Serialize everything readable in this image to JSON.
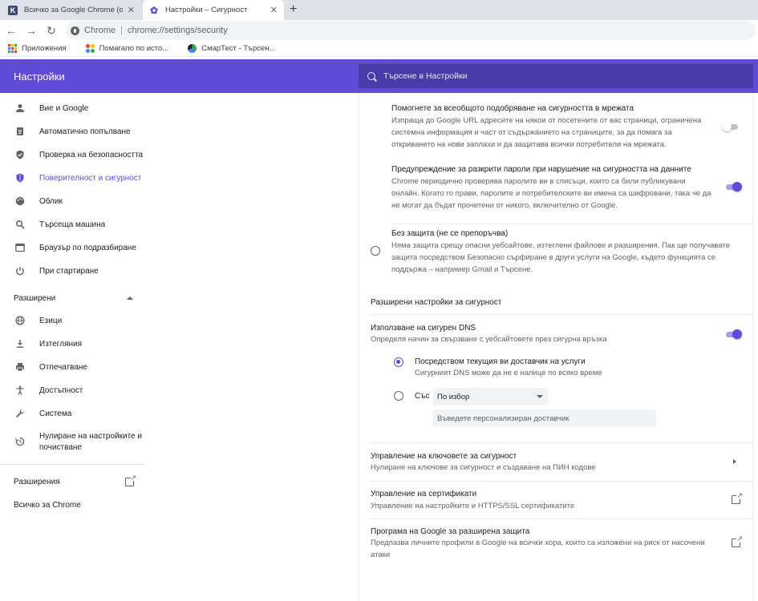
{
  "browser": {
    "tabs": [
      {
        "title": "Всичко за Google Chrome (обе;",
        "favicon": "k-logo-icon",
        "active": false
      },
      {
        "title": "Настройки – Сигурност",
        "favicon": "gear-icon",
        "active": true
      }
    ],
    "omnibox": {
      "site": "Chrome",
      "separator": "|",
      "url": "chrome://settings/security"
    },
    "bookmarks": [
      {
        "label": "Приложения",
        "icon": "apps-grid-icon"
      },
      {
        "label": "Помагало по исто...",
        "icon": "colorful-dots-icon"
      },
      {
        "label": "СмарТест - Търсен...",
        "icon": "globe-icon"
      }
    ]
  },
  "header": {
    "title": "Настройки",
    "search_placeholder": "Търсене в Настройки",
    "color": "#5f4bd7"
  },
  "sidebar": {
    "items": [
      {
        "label": "Вие и Google",
        "icon": "person-icon",
        "active": false
      },
      {
        "label": "Автоматично попълване",
        "icon": "clipboard-icon",
        "active": false
      },
      {
        "label": "Проверка на безопасността",
        "icon": "shield-check-icon",
        "active": false
      },
      {
        "label": "Поверителност и сигурност",
        "icon": "shield-privacy-icon",
        "active": true
      },
      {
        "label": "Облик",
        "icon": "palette-icon",
        "active": false
      },
      {
        "label": "Търсеща машина",
        "icon": "search-icon",
        "active": false
      },
      {
        "label": "Браузър по подразбиране",
        "icon": "browser-icon",
        "active": false
      },
      {
        "label": "При стартиране",
        "icon": "power-icon",
        "active": false
      }
    ],
    "advanced_label": "Разширени",
    "advanced_items": [
      {
        "label": "Езици",
        "icon": "globe-icon"
      },
      {
        "label": "Изтегляния",
        "icon": "download-icon"
      },
      {
        "label": "Отпечатване",
        "icon": "printer-icon"
      },
      {
        "label": "Достъпност",
        "icon": "accessibility-icon"
      },
      {
        "label": "Система",
        "icon": "wrench-icon"
      },
      {
        "label_line1": "Нулиране на настройките и",
        "label_line2": "почистване",
        "icon": "reset-icon"
      }
    ],
    "extensions_label": "Разширения",
    "about_label": "Всичко за Chrome"
  },
  "main": {
    "improve_security": {
      "title": "Помогнете за всеобщото подобряване на сигурността в мрежата",
      "desc_lines": [
        "Изпраща до Google URL адресите на някои от посетените от вас страници, ограничена",
        "системна информация и част от съдържанието на страниците, за да помага за",
        "откриването на нови заплахи и да защитава всички потребители на мрежата."
      ],
      "enabled": false
    },
    "password_leak": {
      "title": "Предупреждение за разкрити пароли при нарушение на сигурността на данните",
      "desc_lines": [
        "Chrome периодично проверява паролите ви в списъци, които са били публикувани",
        "онлайн. Когато го прави, паролите и потребителските ви имена са шифровани, така че да",
        "не могат да бъдат прочетени от никого, включително от Google."
      ],
      "enabled": true
    },
    "no_protection": {
      "title": "Без защита (не се препоръчва)",
      "desc_lines": [
        "Няма защита срещу опасни уебсайтове, изтеглени файлове и разширения. Пак ще получавате",
        "защита посредством Безопасно сърфиране в други услуги на Google, където функцията се",
        "поддържа – например Gmail и Търсене."
      ]
    },
    "advanced_heading": "Разширени настройки за сигурност",
    "secure_dns": {
      "title": "Използване на сигурен DNS",
      "desc": "Определя начин за свързване с уебсайтовете през сигурна връзка",
      "enabled": true,
      "option_current_title": "Посредством текущия ви доставчик на услуги",
      "option_current_desc": "Сигурният DNS може да не е налице по всяко време",
      "option_custom_label": "Със",
      "select_value": "По избор",
      "custom_placeholder": "Въведете персонализиран доставчик"
    },
    "security_keys": {
      "title": "Управление на ключовете за сигурност",
      "desc": "Нулиране на ключове за сигурност и създаване на ПИН кодове"
    },
    "certificates": {
      "title": "Управление на сертификати",
      "desc": "Управление на настройките и HTTPS/SSL сертификатите"
    },
    "advanced_protection": {
      "title": "Програма на Google за разширена защита",
      "desc_lines": [
        "Предпазва личните профили в Google на всички хора, които са изложени на риск от насочени",
        "атаки"
      ]
    }
  }
}
